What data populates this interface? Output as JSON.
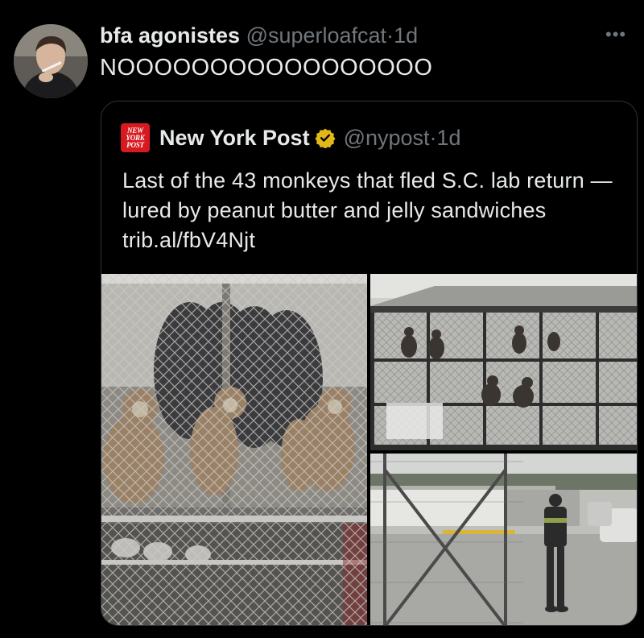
{
  "tweet": {
    "display_name": "bfa agonistes",
    "handle": "@superloafcat",
    "separator": "·",
    "time": "1d",
    "text": "NOOOOOOOOOOOOOOOOO",
    "more_icon": "more-horizontal-icon"
  },
  "quote": {
    "display_name": "New York Post",
    "handle": "@nypost",
    "separator": "·",
    "time": "1d",
    "logo_lines": [
      "NEW",
      "YORK",
      "POST"
    ],
    "verified_icon": "verified-badge-icon",
    "text": "Last of the 43 monkeys that fled S.C. lab return — lured by peanut butter and jelly sandwiches trib.al/fbV4Njt",
    "photos": [
      "monkeys-behind-fence-photo",
      "enclosure-structure-photo",
      "worker-at-gate-photo"
    ]
  },
  "colors": {
    "background": "#000000",
    "text_primary": "#e7e9ea",
    "text_secondary": "#71767b",
    "border": "#2f3336",
    "verified_gold": "#e2b719",
    "np_red": "#d71920"
  }
}
